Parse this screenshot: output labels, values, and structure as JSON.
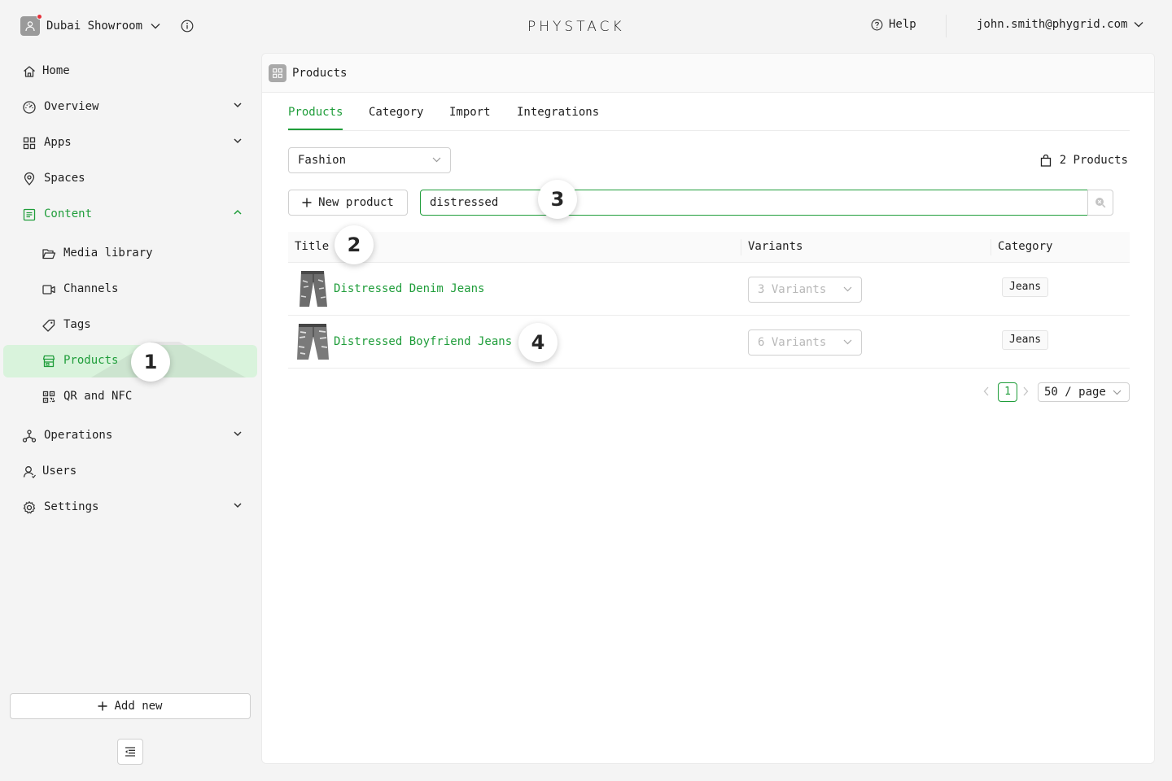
{
  "topbar": {
    "workspace_name": "Dubai Showroom",
    "logo_text": "PHYSTACK",
    "help_label": "Help",
    "user_email": "john.smith@phygrid.com"
  },
  "sidebar": {
    "items": [
      {
        "label": "Home",
        "icon": "home-icon"
      },
      {
        "label": "Overview",
        "icon": "dashboard-icon"
      },
      {
        "label": "Apps",
        "icon": "apps-grid-icon"
      },
      {
        "label": "Spaces",
        "icon": "location-pin-icon"
      },
      {
        "label": "Content",
        "icon": "content-icon"
      },
      {
        "label": "Media library",
        "icon": "folder-open-icon"
      },
      {
        "label": "Channels",
        "icon": "video-camera-icon"
      },
      {
        "label": "Tags",
        "icon": "tag-icon"
      },
      {
        "label": "Products",
        "icon": "shop-icon"
      },
      {
        "label": "QR and NFC",
        "icon": "qrcode-icon"
      },
      {
        "label": "Operations",
        "icon": "cluster-icon"
      },
      {
        "label": "Users",
        "icon": "user-icon"
      },
      {
        "label": "Settings",
        "icon": "gear-icon"
      }
    ],
    "add_new_label": "Add new"
  },
  "main": {
    "header_title": "Products",
    "tabs": [
      {
        "label": "Products",
        "active": true
      },
      {
        "label": "Category",
        "active": false
      },
      {
        "label": "Import",
        "active": false
      },
      {
        "label": "Integrations",
        "active": false
      }
    ],
    "catalog_select_value": "Fashion",
    "product_count_label": "2 Products",
    "new_product_label": "New product",
    "search_value": "distressed",
    "table": {
      "columns": [
        "Title",
        "Variants",
        "Category"
      ],
      "rows": [
        {
          "title": "Distressed Denim Jeans",
          "variants": "3 Variants",
          "category": "Jeans"
        },
        {
          "title": "Distressed Boyfriend Jeans",
          "variants": "6 Variants",
          "category": "Jeans"
        }
      ]
    },
    "pagination": {
      "current_page": "1",
      "page_size": "50 / page"
    }
  },
  "markers": [
    "1",
    "2",
    "3",
    "4"
  ],
  "colors": {
    "accent": "#1f9d3a",
    "active_bg": "#d9f3dc",
    "sidebar_bg": "#f4f4f4",
    "notification_dot": "#e5313a"
  }
}
